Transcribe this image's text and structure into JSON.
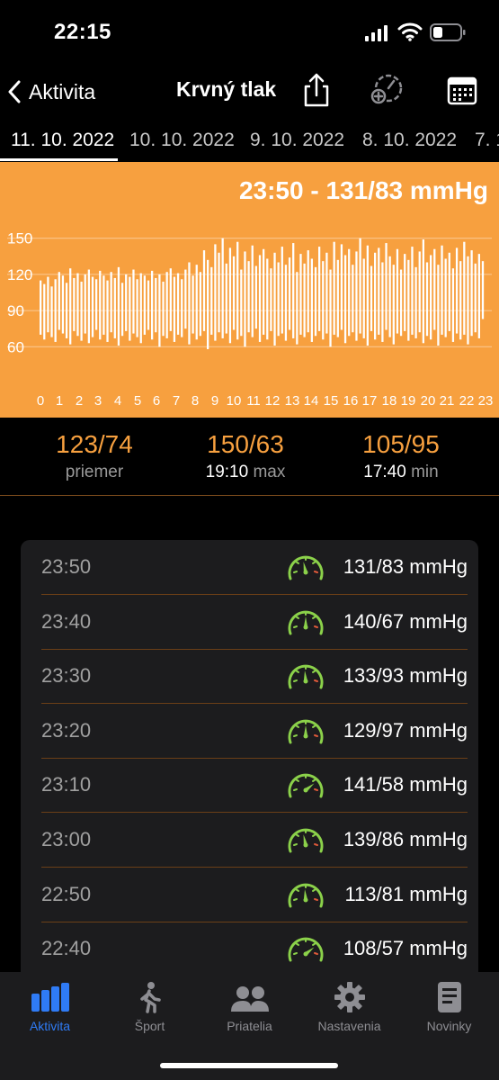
{
  "status": {
    "time": "22:15"
  },
  "nav": {
    "back_label": "Aktivita",
    "title": "Krvný tlak"
  },
  "date_tabs": [
    "11. 10. 2022",
    "10. 10. 2022",
    "9. 10. 2022",
    "8. 10. 2022",
    "7. 1"
  ],
  "chart_data": {
    "type": "bar",
    "title": "23:50 - 131/83 mmHg",
    "yticks": [
      60,
      90,
      120,
      150
    ],
    "ylim": [
      55,
      155
    ],
    "xticks": [
      "0",
      "1",
      "2",
      "3",
      "4",
      "5",
      "6",
      "7",
      "8",
      "9",
      "10",
      "11",
      "12",
      "13",
      "14",
      "15",
      "16",
      "17",
      "18",
      "19",
      "20",
      "21",
      "22",
      "23"
    ],
    "series": [
      {
        "values_systolic": [
          115,
          112,
          118,
          110,
          116,
          122,
          119,
          113,
          125,
          117,
          121,
          114,
          120,
          124,
          118,
          116,
          123,
          119,
          115,
          122,
          117,
          126,
          113,
          120,
          118,
          124,
          116,
          121,
          119,
          115,
          123,
          117,
          120,
          114,
          122,
          125,
          118,
          121,
          116,
          124,
          130,
          119,
          128,
          122,
          140,
          132,
          126,
          145,
          138,
          150,
          129,
          142,
          135,
          147,
          124,
          139,
          131,
          144,
          127,
          136,
          141,
          133,
          125,
          138,
          130,
          143,
          128,
          134,
          146,
          122,
          137,
          129,
          140,
          133,
          126,
          143,
          131,
          138,
          124,
          147,
          132,
          145,
          136,
          141,
          128,
          139,
          150,
          133,
          144,
          127,
          138,
          142,
          130,
          146,
          135,
          128,
          141,
          124,
          137,
          132,
          143,
          126,
          139,
          149,
          130,
          136,
          141,
          128,
          144,
          133,
          138,
          125,
          142,
          131,
          147,
          135,
          140,
          129,
          137,
          131
        ],
        "values_diastolic": [
          70,
          66,
          72,
          68,
          64,
          74,
          71,
          67,
          62,
          73,
          69,
          65,
          71,
          63,
          68,
          74,
          66,
          70,
          64,
          72,
          67,
          61,
          69,
          73,
          65,
          71,
          68,
          63,
          70,
          74,
          66,
          72,
          60,
          69,
          67,
          73,
          64,
          70,
          68,
          75,
          62,
          71,
          66,
          69,
          73,
          58,
          70,
          65,
          72,
          67,
          71,
          63,
          74,
          66,
          69,
          60,
          72,
          68,
          75,
          64,
          70,
          66,
          73,
          61,
          69,
          71,
          65,
          74,
          67,
          62,
          70,
          68,
          72,
          64,
          69,
          73,
          66,
          71,
          60,
          70,
          68,
          74,
          63,
          69,
          72,
          65,
          71,
          67,
          61,
          73,
          66,
          70,
          64,
          74,
          68,
          62,
          71,
          69,
          73,
          65,
          70,
          67,
          72,
          63,
          69,
          66,
          74,
          61,
          70,
          68,
          73,
          64,
          71,
          66,
          70,
          62,
          69,
          72,
          67,
          83
        ]
      }
    ]
  },
  "summary": {
    "avg": {
      "value": "123/74",
      "label": "priemer"
    },
    "max": {
      "value": "150/63",
      "time": "19:10",
      "label": "max"
    },
    "min": {
      "value": "105/95",
      "time": "17:40",
      "label": "min"
    }
  },
  "readings": [
    {
      "time": "23:50",
      "value": "131/83 mmHg",
      "gauge_level": 0.45
    },
    {
      "time": "23:40",
      "value": "140/67 mmHg",
      "gauge_level": 0.5
    },
    {
      "time": "23:30",
      "value": "133/93 mmHg",
      "gauge_level": 0.48
    },
    {
      "time": "23:20",
      "value": "129/97 mmHg",
      "gauge_level": 0.5
    },
    {
      "time": "23:10",
      "value": "141/58 mmHg",
      "gauge_level": 0.72
    },
    {
      "time": "23:00",
      "value": "139/86 mmHg",
      "gauge_level": 0.45
    },
    {
      "time": "22:50",
      "value": "113/81 mmHg",
      "gauge_level": 0.48
    },
    {
      "time": "22:40",
      "value": "108/57 mmHg",
      "gauge_level": 0.72
    }
  ],
  "tabbar": [
    {
      "label": "Aktivita",
      "icon": "bar-chart-icon",
      "active": true
    },
    {
      "label": "Šport",
      "icon": "walking-person-icon",
      "active": false
    },
    {
      "label": "Priatelia",
      "icon": "people-icon",
      "active": false
    },
    {
      "label": "Nastavenia",
      "icon": "gear-icon",
      "active": false
    },
    {
      "label": "Novinky",
      "icon": "document-icon",
      "active": false
    }
  ],
  "colors": {
    "accent": "#f7a03f",
    "active_tab": "#2f7bf5",
    "gauge_green": "#8bd14a"
  }
}
